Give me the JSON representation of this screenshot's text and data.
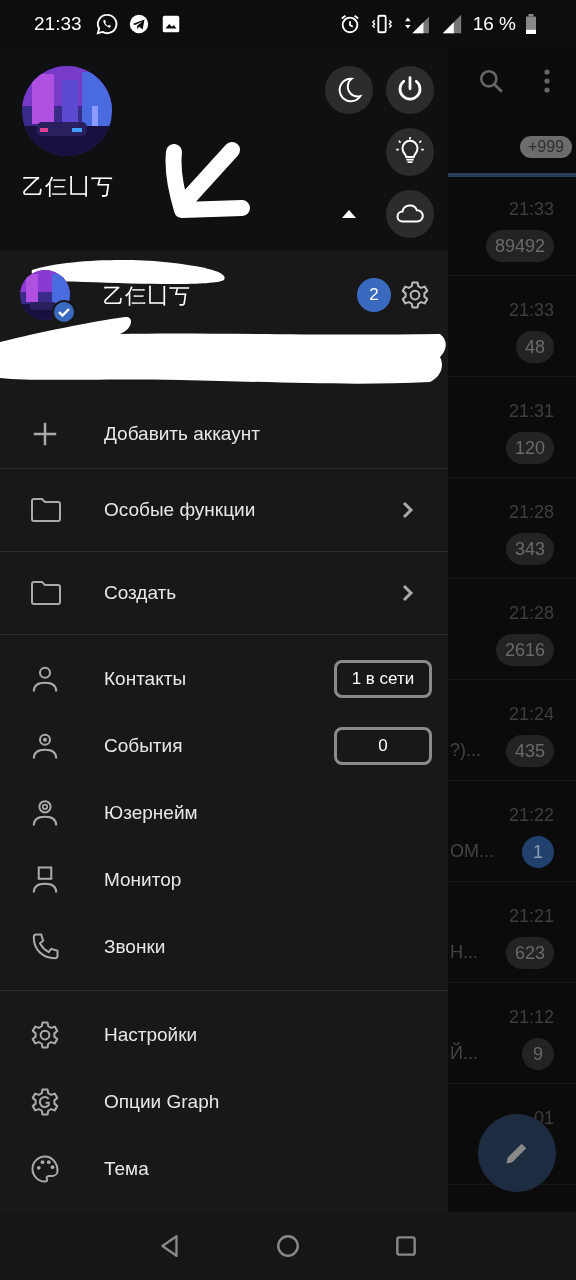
{
  "status_bar": {
    "time": "21:33",
    "battery": "16 %"
  },
  "drawer": {
    "header": {
      "name": "乙仨凵丂",
      "accounts_expanded": true
    },
    "account": {
      "name": "乙仨凵丂",
      "verified": true,
      "badge": "2"
    },
    "add_account": "Добавить аккаунт",
    "folders": [
      {
        "label": "Особые функции"
      },
      {
        "label": "Создать"
      }
    ],
    "menu": [
      {
        "label": "Контакты",
        "badge": "1 в сети"
      },
      {
        "label": "События",
        "badge": "0"
      },
      {
        "label": "Юзернейм"
      },
      {
        "label": "Монитор"
      },
      {
        "label": "Звонки"
      }
    ],
    "settings_menu": [
      {
        "label": "Настройки"
      },
      {
        "label": "Опции Graph"
      },
      {
        "label": "Тема"
      }
    ]
  },
  "chat_list": {
    "total_badge": "+999",
    "rows": [
      {
        "time": "21:33",
        "count": "89492",
        "muted": true
      },
      {
        "time": "21:33",
        "count": "48",
        "muted": true
      },
      {
        "time": "21:31",
        "count": "120",
        "muted": true
      },
      {
        "time": "21:28",
        "count": "343",
        "muted": true
      },
      {
        "time": "21:28",
        "count": "2616",
        "muted": true
      },
      {
        "time": "21:24",
        "count": "435",
        "muted": true,
        "snippet": "?)..."
      },
      {
        "time": "21:22",
        "count": "1",
        "muted": false,
        "snippet": "ОМ..."
      },
      {
        "time": "21:21",
        "count": "623",
        "muted": true,
        "snippet": "Н..."
      },
      {
        "time": "21:12",
        "count": "9",
        "muted": true,
        "snippet": "Й..."
      },
      {
        "time": "01"
      }
    ]
  }
}
